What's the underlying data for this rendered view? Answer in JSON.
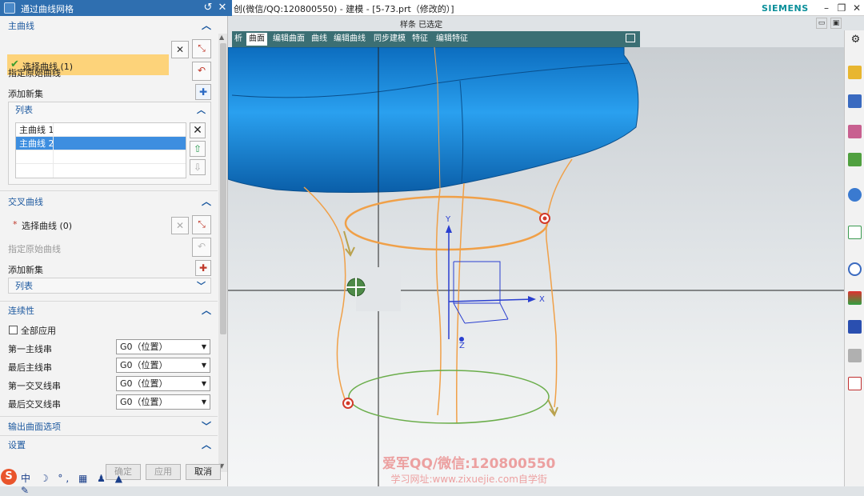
{
  "dialog": {
    "title": "通过曲线网格",
    "reset_icon": "reset-icon",
    "close_icon": "close-icon",
    "primary": {
      "header": "主曲线",
      "select_label": "选择曲线 (1)",
      "specify_origin": "指定原始曲线",
      "add_new_set": "添加新集",
      "list_header": "列表",
      "items": [
        "主曲线 1",
        "主曲线 2"
      ]
    },
    "cross": {
      "header": "交叉曲线",
      "select_label": "选择曲线 (0)",
      "specify_origin": "指定原始曲线",
      "add_new_set": "添加新集",
      "list_header": "列表"
    },
    "continuity": {
      "header": "连续性",
      "apply_all": "全部应用",
      "rows": [
        {
          "label": "第一主线串",
          "value": "G0（位置）"
        },
        {
          "label": "最后主线串",
          "value": "G0（位置）"
        },
        {
          "label": "第一交叉线串",
          "value": "G0（位置）"
        },
        {
          "label": "最后交叉线串",
          "value": "G0（位置）"
        }
      ]
    },
    "output_options": "输出曲面选项",
    "settings": "设置",
    "buttons": {
      "ok": "确定",
      "apply": "应用",
      "cancel": "取消"
    }
  },
  "window": {
    "title": "创(微信/QQ:120800550) - 建模 - [5-73.prt（修改的）]",
    "brand": "SIEMENS",
    "status": "样条 已选定"
  },
  "ribbon": {
    "tabs": [
      "析",
      "曲面",
      "编辑曲面",
      "曲线",
      "编辑曲线",
      "同步建模",
      "特征",
      "编辑特征"
    ],
    "active": "曲面"
  },
  "axes": {
    "x": "X",
    "y": "Y",
    "z": "Z"
  },
  "ime": {
    "logo": "S",
    "text": "中 ☽ °, ▦ ♟ ▲ ✎"
  },
  "watermark": {
    "line1": "爱军QQ/微信:120800550",
    "line2": "学习网址:www.zixuejie.com自学街"
  },
  "colors": {
    "panel_header": "#1e5aa0",
    "selection": "#fdd37a",
    "ribbon": "#3b6f74",
    "surface": "#1a85d6",
    "orange_curve": "#f0a048",
    "green_curve": "#6aad4a"
  }
}
